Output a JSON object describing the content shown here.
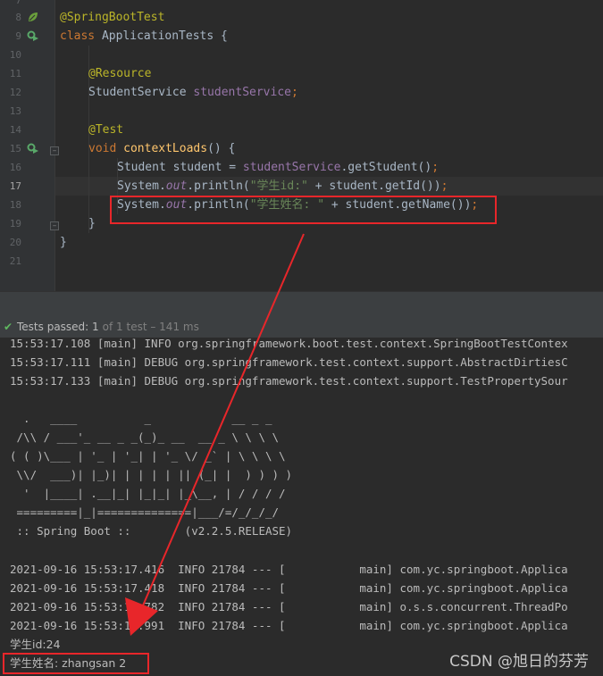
{
  "editor": {
    "lines": [
      {
        "num": "7",
        "text": ""
      },
      {
        "num": "8",
        "text": "@SpringBootTest"
      },
      {
        "num": "9",
        "text": "class ApplicationTests {"
      },
      {
        "num": "10",
        "text": ""
      },
      {
        "num": "11",
        "text": "@Resource"
      },
      {
        "num": "12",
        "text": "StudentService studentService;"
      },
      {
        "num": "13",
        "text": ""
      },
      {
        "num": "14",
        "text": "@Test"
      },
      {
        "num": "15",
        "text": "void contextLoads() {"
      },
      {
        "num": "16",
        "text": "Student student = studentService.getStudent();"
      },
      {
        "num": "17",
        "text": "System.out.println(\"学生id:\" + student.getId());"
      },
      {
        "num": "18",
        "text": "System.out.println(\"学生姓名: \" + student.getName());"
      },
      {
        "num": "19",
        "text": "}"
      },
      {
        "num": "20",
        "text": "}"
      },
      {
        "num": "21",
        "text": ""
      }
    ],
    "gutter_icons": [
      "spring-bean-icon",
      "run-test-icon",
      "run-test-icon"
    ],
    "colors": {
      "background": "#2b2b2b",
      "keyword": "#cc7832",
      "annotation": "#bbb529",
      "field": "#9876aa",
      "method": "#ffc66d",
      "string": "#6a8759",
      "text": "#a9b7c6"
    }
  },
  "status": {
    "passed_label": "Tests passed: 1",
    "summary": "of 1 test – 141 ms",
    "check_icon": "check-icon",
    "check_color": "#5fb85f"
  },
  "console": {
    "lines": [
      "15:53:17.108 [main] INFO org.springframework.boot.test.context.SpringBootTestContex",
      "15:53:17.111 [main] DEBUG org.springframework.test.context.support.AbstractDirtiesC",
      "15:53:17.133 [main] DEBUG org.springframework.test.context.support.TestPropertySour",
      "",
      "  .   ____          _            __ _ _",
      " /\\\\ / ___'_ __ _ _(_)_ __  __ _ \\ \\ \\ \\",
      "( ( )\\___ | '_ | '_| | '_ \\/ _` | \\ \\ \\ \\",
      " \\\\/  ___)| |_)| | | | | || (_| |  ) ) ) )",
      "  '  |____| .__|_| |_|_| |_\\__, | / / / /",
      " =========|_|==============|___/=/_/_/_/",
      " :: Spring Boot ::        (v2.2.5.RELEASE)",
      "",
      "2021-09-16 15:53:17.416  INFO 21784 --- [           main] com.yc.springboot.Applica",
      "2021-09-16 15:53:17.418  INFO 21784 --- [           main] com.yc.springboot.Applica",
      "2021-09-16 15:53:18.782  INFO 21784 --- [           main] o.s.s.concurrent.ThreadPo",
      "2021-09-16 15:53:18.991  INFO 21784 --- [           main] com.yc.springboot.Applica",
      "学生id:24",
      "学生姓名: zhangsan 2"
    ]
  },
  "annotation": {
    "highlight_color": "#e8262a",
    "arrow_icon": "red-arrow"
  },
  "watermark": "CSDN @旭日的芬芳"
}
